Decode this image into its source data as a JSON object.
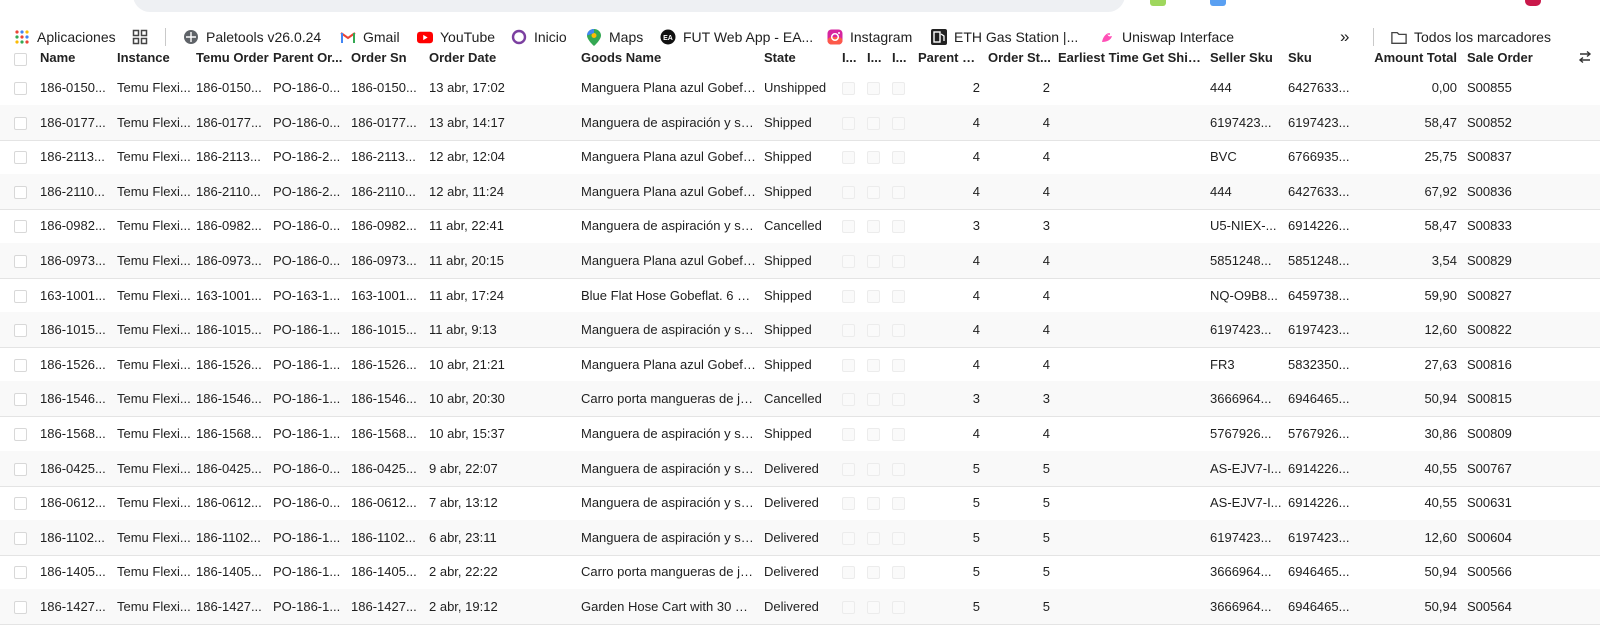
{
  "bookmarks": {
    "apps": "Aplicaciones",
    "items": [
      {
        "label": "Paletools v26.0.24",
        "icon": "paletools-icon"
      },
      {
        "label": "Gmail",
        "icon": "gmail-icon"
      },
      {
        "label": "YouTube",
        "icon": "youtube-icon"
      },
      {
        "label": "Inicio",
        "icon": "inicio-icon"
      },
      {
        "label": "Maps",
        "icon": "maps-icon"
      },
      {
        "label": "FUT Web App - EA...",
        "icon": "ea-icon"
      },
      {
        "label": "Instagram",
        "icon": "instagram-icon"
      },
      {
        "label": "ETH Gas Station |...",
        "icon": "ethgas-icon"
      },
      {
        "label": "Uniswap Interface",
        "icon": "uniswap-icon"
      }
    ],
    "overflow": "»",
    "all_bookmarks": "Todos los marcadores"
  },
  "table": {
    "columns": {
      "name": "Name",
      "instance": "Instance",
      "temu_order": "Temu Order",
      "parent_order": "Parent Or...",
      "order_sn": "Order Sn",
      "order_date": "Order Date",
      "goods_name": "Goods Name",
      "state": "State",
      "c1": "I...",
      "c2": "I...",
      "c3": "I...",
      "parent_o": "Parent O...",
      "order_st": "Order St...",
      "earliest": "Earliest Time Get Ship...",
      "seller_sku": "Seller Sku",
      "sku": "Sku",
      "amount_total": "Amount Total",
      "sale_order": "Sale Order"
    },
    "rows": [
      {
        "name": "186-0150...",
        "instance": "Temu Flexi...",
        "temu_order": "186-0150...",
        "parent_order": "PO-186-0...",
        "order_sn": "186-0150...",
        "order_date": "13 abr, 17:02",
        "goods_name": "Manguera Plana azul Gobefla...",
        "state": "Unshipped",
        "parent_o": "2",
        "order_st": "2",
        "seller_sku": "444",
        "sku": "6427633...",
        "amount_total": "0,00",
        "sale_order": "S00855"
      },
      {
        "name": "186-0177...",
        "instance": "Temu Flexi...",
        "temu_order": "186-0177...",
        "parent_order": "PO-186-0...",
        "order_sn": "186-0177...",
        "order_date": "13 abr, 14:17",
        "goods_name": "Manguera de aspiración y su...",
        "state": "Shipped",
        "parent_o": "4",
        "order_st": "4",
        "seller_sku": "6197423...",
        "sku": "6197423...",
        "amount_total": "58,47",
        "sale_order": "S00852"
      },
      {
        "name": "186-2113...",
        "instance": "Temu Flexi...",
        "temu_order": "186-2113...",
        "parent_order": "PO-186-2...",
        "order_sn": "186-2113...",
        "order_date": "12 abr, 12:04",
        "goods_name": "Manguera Plana azul Gobefla...",
        "state": "Shipped",
        "parent_o": "4",
        "order_st": "4",
        "seller_sku": "BVC",
        "sku": "6766935...",
        "amount_total": "25,75",
        "sale_order": "S00837"
      },
      {
        "name": "186-2110...",
        "instance": "Temu Flexi...",
        "temu_order": "186-2110...",
        "parent_order": "PO-186-2...",
        "order_sn": "186-2110...",
        "order_date": "12 abr, 11:24",
        "goods_name": "Manguera Plana azul Gobefla...",
        "state": "Shipped",
        "parent_o": "4",
        "order_st": "4",
        "seller_sku": "444",
        "sku": "6427633...",
        "amount_total": "67,92",
        "sale_order": "S00836"
      },
      {
        "name": "186-0982...",
        "instance": "Temu Flexi...",
        "temu_order": "186-0982...",
        "parent_order": "PO-186-0...",
        "order_sn": "186-0982...",
        "order_date": "11 abr, 22:41",
        "goods_name": "Manguera de aspiración y su...",
        "state": "Cancelled",
        "parent_o": "3",
        "order_st": "3",
        "seller_sku": "U5-NIEX-...",
        "sku": "6914226...",
        "amount_total": "58,47",
        "sale_order": "S00833"
      },
      {
        "name": "186-0973...",
        "instance": "Temu Flexi...",
        "temu_order": "186-0973...",
        "parent_order": "PO-186-0...",
        "order_sn": "186-0973...",
        "order_date": "11 abr, 20:15",
        "goods_name": "Manguera Plana azul Gobefla...",
        "state": "Shipped",
        "parent_o": "4",
        "order_st": "4",
        "seller_sku": "5851248...",
        "sku": "5851248...",
        "amount_total": "3,54",
        "sale_order": "S00829"
      },
      {
        "name": "163-1001...",
        "instance": "Temu Flexi...",
        "temu_order": "163-1001...",
        "parent_order": "PO-163-1...",
        "order_sn": "163-1001...",
        "order_date": "11 abr, 17:24",
        "goods_name": "Blue Flat Hose Gobeflat. 6 Ba...",
        "state": "Shipped",
        "parent_o": "4",
        "order_st": "4",
        "seller_sku": "NQ-O9B8...",
        "sku": "6459738...",
        "amount_total": "59,90",
        "sale_order": "S00827"
      },
      {
        "name": "186-1015...",
        "instance": "Temu Flexi...",
        "temu_order": "186-1015...",
        "parent_order": "PO-186-1...",
        "order_sn": "186-1015...",
        "order_date": "11 abr, 9:13",
        "goods_name": "Manguera de aspiración y su...",
        "state": "Shipped",
        "parent_o": "4",
        "order_st": "4",
        "seller_sku": "6197423...",
        "sku": "6197423...",
        "amount_total": "12,60",
        "sale_order": "S00822"
      },
      {
        "name": "186-1526...",
        "instance": "Temu Flexi...",
        "temu_order": "186-1526...",
        "parent_order": "PO-186-1...",
        "order_sn": "186-1526...",
        "order_date": "10 abr, 21:21",
        "goods_name": "Manguera Plana azul Gobefla...",
        "state": "Shipped",
        "parent_o": "4",
        "order_st": "4",
        "seller_sku": "FR3",
        "sku": "5832350...",
        "amount_total": "27,63",
        "sale_order": "S00816"
      },
      {
        "name": "186-1546...",
        "instance": "Temu Flexi...",
        "temu_order": "186-1546...",
        "parent_order": "PO-186-1...",
        "order_sn": "186-1546...",
        "order_date": "10 abr, 20:30",
        "goods_name": "Carro porta mangueras de jar...",
        "state": "Cancelled",
        "parent_o": "3",
        "order_st": "3",
        "seller_sku": "3666964...",
        "sku": "6946465...",
        "amount_total": "50,94",
        "sale_order": "S00815"
      },
      {
        "name": "186-1568...",
        "instance": "Temu Flexi...",
        "temu_order": "186-1568...",
        "parent_order": "PO-186-1...",
        "order_sn": "186-1568...",
        "order_date": "10 abr, 15:37",
        "goods_name": "Manguera de aspiración y su...",
        "state": "Shipped",
        "parent_o": "4",
        "order_st": "4",
        "seller_sku": "5767926...",
        "sku": "5767926...",
        "amount_total": "30,86",
        "sale_order": "S00809"
      },
      {
        "name": "186-0425...",
        "instance": "Temu Flexi...",
        "temu_order": "186-0425...",
        "parent_order": "PO-186-0...",
        "order_sn": "186-0425...",
        "order_date": "9 abr, 22:07",
        "goods_name": "Manguera de aspiración y su...",
        "state": "Delivered",
        "parent_o": "5",
        "order_st": "5",
        "seller_sku": "AS-EJV7-I...",
        "sku": "6914226...",
        "amount_total": "40,55",
        "sale_order": "S00767"
      },
      {
        "name": "186-0612...",
        "instance": "Temu Flexi...",
        "temu_order": "186-0612...",
        "parent_order": "PO-186-0...",
        "order_sn": "186-0612...",
        "order_date": "7 abr, 13:12",
        "goods_name": "Manguera de aspiración y su...",
        "state": "Delivered",
        "parent_o": "5",
        "order_st": "5",
        "seller_sku": "AS-EJV7-I...",
        "sku": "6914226...",
        "amount_total": "40,55",
        "sale_order": "S00631"
      },
      {
        "name": "186-1102...",
        "instance": "Temu Flexi...",
        "temu_order": "186-1102...",
        "parent_order": "PO-186-1...",
        "order_sn": "186-1102...",
        "order_date": "6 abr, 23:11",
        "goods_name": "Manguera de aspiración y su...",
        "state": "Delivered",
        "parent_o": "5",
        "order_st": "5",
        "seller_sku": "6197423...",
        "sku": "6197423...",
        "amount_total": "12,60",
        "sale_order": "S00604"
      },
      {
        "name": "186-1405...",
        "instance": "Temu Flexi...",
        "temu_order": "186-1405...",
        "parent_order": "PO-186-1...",
        "order_sn": "186-1405...",
        "order_date": "2 abr, 22:22",
        "goods_name": "Carro porta mangueras de jar...",
        "state": "Delivered",
        "parent_o": "5",
        "order_st": "5",
        "seller_sku": "3666964...",
        "sku": "6946465...",
        "amount_total": "50,94",
        "sale_order": "S00566"
      },
      {
        "name": "186-1427...",
        "instance": "Temu Flexi...",
        "temu_order": "186-1427...",
        "parent_order": "PO-186-1...",
        "order_sn": "186-1427...",
        "order_date": "2 abr, 19:12",
        "goods_name": "Garden Hose Cart with 30 M...",
        "state": "Delivered",
        "parent_o": "5",
        "order_st": "5",
        "seller_sku": "3666964...",
        "sku": "6946465...",
        "amount_total": "50,94",
        "sale_order": "S00564"
      }
    ]
  }
}
